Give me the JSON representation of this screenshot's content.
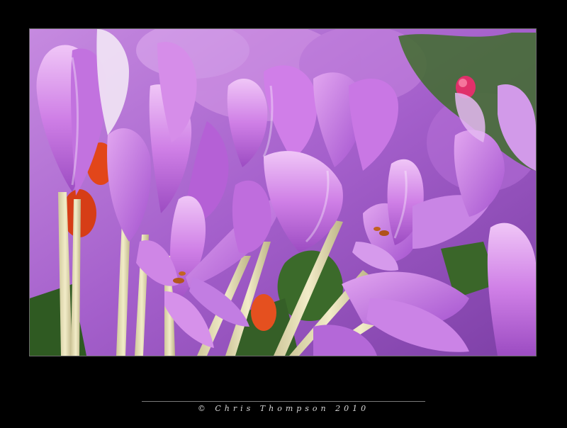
{
  "photo": {
    "subject_icon": "flower-photo-icon",
    "palette": {
      "petal_light": "#e6a8f2",
      "petal_mid": "#c46fe0",
      "petal_dark": "#8d3fb3",
      "stem": "#e8e0b8",
      "leaf": "#3d6b2c",
      "accent_orange": "#e2461a",
      "rose_bud": "#e0306a"
    }
  },
  "credit": {
    "text": "© Chris Thompson 2010"
  }
}
